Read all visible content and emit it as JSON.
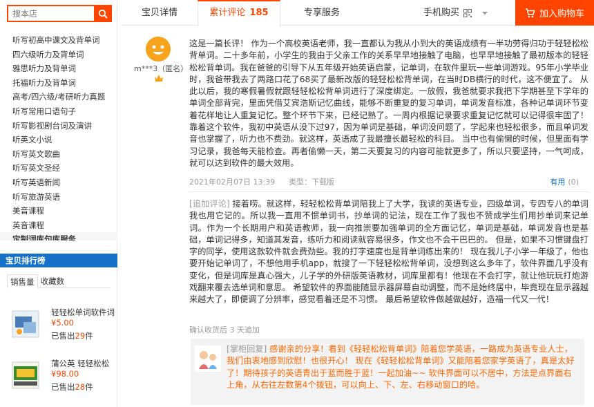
{
  "search": {
    "placeholder": "搜本店"
  },
  "categories": [
    "听写初高中课文及背单词",
    "四六级听力及背单词",
    "雅思听力及背单词",
    "托福听力及背单词",
    "高考/四六级/考研听力真题",
    "听写常用口语句子",
    "听写影视剧台词及演讲",
    "听英文小说",
    "听写英文歌曲",
    "听写英文圣经",
    "听写英语新闻",
    "听写旅游英语",
    "美音课程",
    "英音课程",
    "定制词库句库服务"
  ],
  "ranking": {
    "title": "宝贝排行榜",
    "tabs": [
      "销售量",
      "收藏数"
    ],
    "products": [
      {
        "name": "轻轻松单词软件词",
        "price": "¥5.00",
        "sold_prefix": "已售出",
        "sold_count": "29",
        "sold_suffix": "件"
      },
      {
        "name": "蒲公英 轻轻松松",
        "price": "¥98.00",
        "sold_prefix": "已售出",
        "sold_count": "28",
        "sold_suffix": "件"
      }
    ]
  },
  "tabs": {
    "details": "宝贝详情",
    "reviews": "累计评论",
    "reviews_count": "185",
    "service": "专享服务",
    "phone_buy": "手机购买",
    "add_to_cart": "加入购物车"
  },
  "review": {
    "user": "m***3（匿名）",
    "text": "这是一篇长评！ 作为一个高校英语老师，我一直都认为我从小到大的英语成绩有一半功劳得归功于轻轻松松背单词。二十多年前，小学生的我由于父亲工作的关系早早地接触了电脑，也早早地接触了最初版本的轻轻松松背单词。我在爸爸的引导下从五年级开始英语启蒙，记单词，在软件里玩一些单词游戏。95年小学毕业时，我爸带我去了两路口花了68买了最新改版的轻轻松松背单词，在当时DB横行的时代，这不便宜了。 从此以后，我的寒假暑假就跟轻轻松松背单词进行了深度绑定。一放假，我爸就要求我把下学期甚至下学年的单词全部背完，里面凭借艾宾浩斯记忆曲线，能够不断重复的复习单词，单词发音标准，各种记单词环节变着花样地让人重复记忆。整个环节下来，已经记熟了。一周内根据记录要求重复记忆就可以记得很牢固了！靠着这个软件，我初中英语从没下过97，因为单词是基础，单词没问题了，学起来也轻松很多，而且单词发音也掌握了，听力也不费劲。就这样，英语成了我最擅长最轻松的科目。 当中也有偷懒的时候，但里面有学习记录，我爸每天能检查。再者偷懒一天，第二天要复习的内容可能就更多了，所以只要坚持，一气呵成，就可以达到软件的最大效用。",
    "date": "2021年02月07日 13:39",
    "type": "类型：下载版",
    "helpful_label": "有用",
    "helpful_count": "(0)",
    "append_label": "[追加评论]",
    "append_text": " 接着唠。就这样，轻轻松松背单词陪我上了大学，我读的英语专业，四级单词，专四专八的单词我也用它记的。所以我一直用不惯单词书，抄单词的记法，现在工作了我也不赞成学生们用抄单词来记单词。作为一个长期用户和英语教师，我一向推崇要加强单词的全方面记忆，单词是基础，单词发音也是基础，单词记得多，知道其发音，练听力和阅读就容易很多，作文也不会干巴巴的。 但是，如果不习惯键盘打字的同学，使用这款软件就会费劲些。我的打字速度也是背单词练出来的！ 现在我儿子小学一年级了，他也要开始记单词了，不想他用手机app，就搜了一下轻轻松松背单词，没想到这么多年了，软件界面几乎没有变化，但是词库是真心强大，儿子学的外研版英语教材，词库里都有！他现在不会打字，就让他玩玩打炮游戏翻来覆去选单词和意思。 希望软件的界面能随显示器屏幕自动调整，而不是始终居中，毕竟现在显示器越来越大了，即便调了分辨率，感觉看着还是不习惯。 最后希望软件做越做越好，造福一代又一代！",
    "append_meta": "确认收货后 3 天追加",
    "reply_label": "[掌柜回复]",
    "reply_text": " 感谢亲的分享！看到《轻轻松松背单词》陪着您学英语，一路成为英语专业人士，我们由衷地感到欣慰！也很开心！ 现在《轻轻松松背单词》又能陪着您家学英语了，真是太好了！期待孩子的英语青出于蓝而胜于蓝！一起加油~~ 软件界面可以不居中，方法是点界面右上角，从右往左数第4个拨钮，可以向上、下、左、右移动窗口的哈。"
  },
  "colors": {
    "accent": "#ff4400",
    "link": "#1571c7",
    "reply": "#ff6600"
  }
}
